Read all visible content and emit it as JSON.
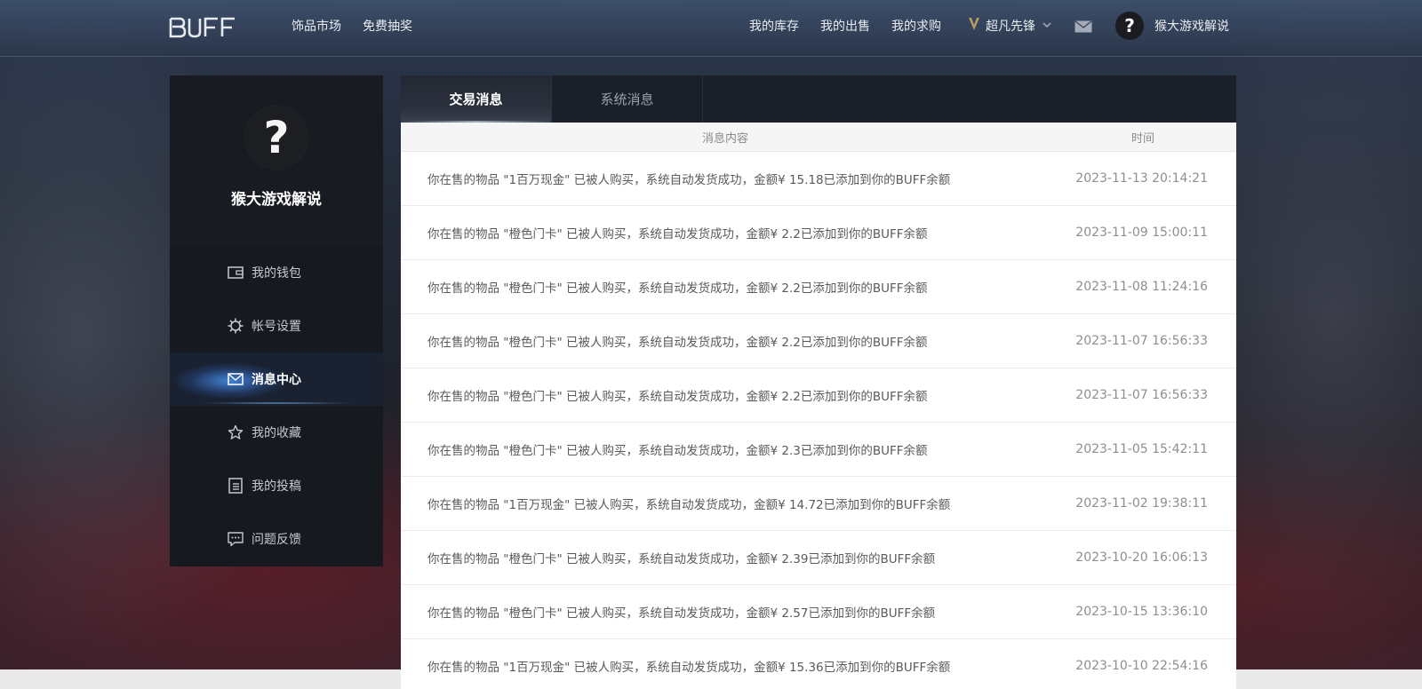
{
  "header": {
    "logo_text": "BUFF",
    "nav_left": [
      "饰品市场",
      "免费抽奖"
    ],
    "nav_right": [
      "我的库存",
      "我的出售",
      "我的求购"
    ],
    "level": "超凡先锋",
    "username": "猴大游戏解说",
    "avatar_glyph": "?"
  },
  "sidebar": {
    "avatar_glyph": "?",
    "username": "猴大游戏解说",
    "items": [
      {
        "label": "我的钱包",
        "icon": "wallet-icon",
        "active": false
      },
      {
        "label": "帐号设置",
        "icon": "gear-icon",
        "active": false
      },
      {
        "label": "消息中心",
        "icon": "mail-icon",
        "active": true
      },
      {
        "label": "我的收藏",
        "icon": "star-icon",
        "active": false
      },
      {
        "label": "我的投稿",
        "icon": "document-icon",
        "active": false
      },
      {
        "label": "问题反馈",
        "icon": "chat-icon",
        "active": false
      }
    ]
  },
  "tabs": [
    {
      "label": "交易消息",
      "active": true
    },
    {
      "label": "系统消息",
      "active": false
    }
  ],
  "table": {
    "headers": {
      "content": "消息内容",
      "time": "时间"
    },
    "rows": [
      {
        "content": "你在售的物品 \"1百万现金\" 已被人购买，系统自动发货成功，金额¥ 15.18已添加到你的BUFF余额",
        "time": "2023-11-13 20:14:21"
      },
      {
        "content": "你在售的物品 \"橙色门卡\" 已被人购买，系统自动发货成功，金额¥ 2.2已添加到你的BUFF余额",
        "time": "2023-11-09 15:00:11"
      },
      {
        "content": "你在售的物品 \"橙色门卡\" 已被人购买，系统自动发货成功，金额¥ 2.2已添加到你的BUFF余额",
        "time": "2023-11-08 11:24:16"
      },
      {
        "content": "你在售的物品 \"橙色门卡\" 已被人购买，系统自动发货成功，金额¥ 2.2已添加到你的BUFF余额",
        "time": "2023-11-07 16:56:33"
      },
      {
        "content": "你在售的物品 \"橙色门卡\" 已被人购买，系统自动发货成功，金额¥ 2.2已添加到你的BUFF余额",
        "time": "2023-11-07 16:56:33"
      },
      {
        "content": "你在售的物品 \"橙色门卡\" 已被人购买，系统自动发货成功，金额¥ 2.3已添加到你的BUFF余额",
        "time": "2023-11-05 15:42:11"
      },
      {
        "content": "你在售的物品 \"1百万现金\" 已被人购买，系统自动发货成功，金额¥ 14.72已添加到你的BUFF余额",
        "time": "2023-11-02 19:38:11"
      },
      {
        "content": "你在售的物品 \"橙色门卡\" 已被人购买，系统自动发货成功，金额¥ 2.39已添加到你的BUFF余额",
        "time": "2023-10-20 16:06:13"
      },
      {
        "content": "你在售的物品 \"橙色门卡\" 已被人购买，系统自动发货成功，金额¥ 2.57已添加到你的BUFF余额",
        "time": "2023-10-15 13:36:10"
      },
      {
        "content": "你在售的物品 \"1百万现金\" 已被人购买，系统自动发货成功，金额¥ 15.36已添加到你的BUFF余额",
        "time": "2023-10-10 22:54:16"
      }
    ]
  },
  "colors": {
    "accent_blue": "#3c7fd8",
    "level_gold": "#c9a86a",
    "sidebar_bg": "#15181d"
  }
}
